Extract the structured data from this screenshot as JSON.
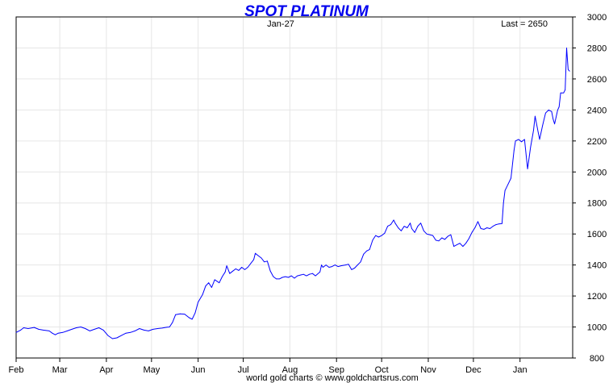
{
  "chart_data": {
    "type": "line",
    "title": "SPOT PLATINUM",
    "date_label": "Jan-27",
    "last_label": "Last = 2650",
    "footer": "world gold charts © www.goldchartsrus.com",
    "xlabel": "",
    "ylabel": "",
    "ylim": [
      800,
      3000
    ],
    "y_ticks": [
      800,
      1000,
      1200,
      1400,
      1600,
      1800,
      2000,
      2200,
      2400,
      2600,
      2800,
      3000
    ],
    "x_ticks": [
      {
        "label": "Feb",
        "day": 0
      },
      {
        "label": "Mar",
        "day": 29
      },
      {
        "label": "Apr",
        "day": 60
      },
      {
        "label": "May",
        "day": 90
      },
      {
        "label": "Jun",
        "day": 121
      },
      {
        "label": "Jul",
        "day": 151
      },
      {
        "label": "Aug",
        "day": 182
      },
      {
        "label": "Sep",
        "day": 213
      },
      {
        "label": "Oct",
        "day": 243
      },
      {
        "label": "Nov",
        "day": 274
      },
      {
        "label": "Dec",
        "day": 304
      },
      {
        "label": "Jan",
        "day": 335
      }
    ],
    "grid": true,
    "series": [
      {
        "name": "",
        "color": "#0000ff",
        "points": [
          [
            0,
            965
          ],
          [
            3,
            980
          ],
          [
            5,
            995
          ],
          [
            8,
            990
          ],
          [
            12,
            997
          ],
          [
            15,
            985
          ],
          [
            18,
            980
          ],
          [
            22,
            975
          ],
          [
            24,
            960
          ],
          [
            26,
            950
          ],
          [
            28,
            960
          ],
          [
            31,
            965
          ],
          [
            34,
            975
          ],
          [
            37,
            985
          ],
          [
            40,
            995
          ],
          [
            43,
            1000
          ],
          [
            46,
            990
          ],
          [
            49,
            975
          ],
          [
            52,
            985
          ],
          [
            55,
            995
          ],
          [
            58,
            980
          ],
          [
            61,
            945
          ],
          [
            64,
            925
          ],
          [
            67,
            930
          ],
          [
            70,
            945
          ],
          [
            73,
            960
          ],
          [
            76,
            965
          ],
          [
            79,
            975
          ],
          [
            82,
            990
          ],
          [
            85,
            980
          ],
          [
            88,
            975
          ],
          [
            91,
            985
          ],
          [
            94,
            990
          ],
          [
            97,
            993
          ],
          [
            100,
            998
          ],
          [
            102,
            1000
          ],
          [
            104,
            1030
          ],
          [
            106,
            1080
          ],
          [
            109,
            1085
          ],
          [
            112,
            1083
          ],
          [
            115,
            1060
          ],
          [
            117,
            1050
          ],
          [
            119,
            1090
          ],
          [
            121,
            1160
          ],
          [
            124,
            1210
          ],
          [
            126,
            1265
          ],
          [
            128,
            1285
          ],
          [
            130,
            1255
          ],
          [
            132,
            1305
          ],
          [
            135,
            1285
          ],
          [
            137,
            1325
          ],
          [
            139,
            1355
          ],
          [
            140,
            1395
          ],
          [
            142,
            1345
          ],
          [
            144,
            1360
          ],
          [
            146,
            1375
          ],
          [
            148,
            1365
          ],
          [
            150,
            1385
          ],
          [
            152,
            1370
          ],
          [
            154,
            1385
          ],
          [
            156,
            1410
          ],
          [
            158,
            1435
          ],
          [
            159,
            1475
          ],
          [
            161,
            1460
          ],
          [
            163,
            1445
          ],
          [
            165,
            1420
          ],
          [
            167,
            1425
          ],
          [
            169,
            1360
          ],
          [
            171,
            1325
          ],
          [
            173,
            1310
          ],
          [
            175,
            1310
          ],
          [
            177,
            1320
          ],
          [
            179,
            1325
          ],
          [
            181,
            1320
          ],
          [
            183,
            1330
          ],
          [
            185,
            1315
          ],
          [
            187,
            1330
          ],
          [
            189,
            1335
          ],
          [
            191,
            1340
          ],
          [
            193,
            1330
          ],
          [
            195,
            1340
          ],
          [
            197,
            1345
          ],
          [
            199,
            1330
          ],
          [
            202,
            1355
          ],
          [
            203,
            1400
          ],
          [
            204,
            1385
          ],
          [
            206,
            1400
          ],
          [
            208,
            1385
          ],
          [
            210,
            1390
          ],
          [
            212,
            1400
          ],
          [
            214,
            1390
          ],
          [
            216,
            1395
          ],
          [
            219,
            1400
          ],
          [
            221,
            1405
          ],
          [
            223,
            1370
          ],
          [
            225,
            1380
          ],
          [
            227,
            1400
          ],
          [
            229,
            1420
          ],
          [
            231,
            1470
          ],
          [
            233,
            1490
          ],
          [
            235,
            1500
          ],
          [
            237,
            1560
          ],
          [
            239,
            1590
          ],
          [
            241,
            1580
          ],
          [
            243,
            1590
          ],
          [
            245,
            1605
          ],
          [
            247,
            1650
          ],
          [
            249,
            1660
          ],
          [
            251,
            1690
          ],
          [
            252,
            1670
          ],
          [
            254,
            1640
          ],
          [
            256,
            1620
          ],
          [
            258,
            1650
          ],
          [
            260,
            1640
          ],
          [
            262,
            1670
          ],
          [
            263,
            1635
          ],
          [
            265,
            1610
          ],
          [
            267,
            1650
          ],
          [
            269,
            1670
          ],
          [
            271,
            1620
          ],
          [
            273,
            1600
          ],
          [
            275,
            1595
          ],
          [
            277,
            1590
          ],
          [
            279,
            1560
          ],
          [
            281,
            1555
          ],
          [
            283,
            1575
          ],
          [
            285,
            1565
          ],
          [
            287,
            1585
          ],
          [
            289,
            1595
          ],
          [
            291,
            1520
          ],
          [
            293,
            1530
          ],
          [
            295,
            1540
          ],
          [
            297,
            1520
          ],
          [
            299,
            1540
          ],
          [
            301,
            1570
          ],
          [
            303,
            1610
          ],
          [
            305,
            1640
          ],
          [
            307,
            1680
          ],
          [
            309,
            1635
          ],
          [
            311,
            1630
          ],
          [
            313,
            1640
          ],
          [
            315,
            1635
          ],
          [
            317,
            1650
          ],
          [
            319,
            1660
          ],
          [
            321,
            1665
          ],
          [
            323,
            1667
          ],
          [
            324,
            1800
          ],
          [
            325,
            1880
          ],
          [
            327,
            1920
          ],
          [
            329,
            1960
          ],
          [
            331,
            2140
          ],
          [
            332,
            2200
          ],
          [
            334,
            2210
          ],
          [
            336,
            2195
          ],
          [
            338,
            2210
          ],
          [
            340,
            2020
          ],
          [
            342,
            2160
          ],
          [
            344,
            2270
          ],
          [
            345,
            2360
          ],
          [
            347,
            2260
          ],
          [
            348,
            2210
          ],
          [
            350,
            2300
          ],
          [
            352,
            2380
          ],
          [
            354,
            2400
          ],
          [
            356,
            2390
          ],
          [
            357,
            2340
          ],
          [
            358,
            2310
          ],
          [
            360,
            2400
          ],
          [
            361,
            2420
          ],
          [
            362,
            2510
          ],
          [
            364,
            2510
          ],
          [
            365,
            2530
          ],
          [
            366,
            2800
          ],
          [
            367,
            2660
          ],
          [
            368,
            2650
          ]
        ]
      }
    ]
  }
}
